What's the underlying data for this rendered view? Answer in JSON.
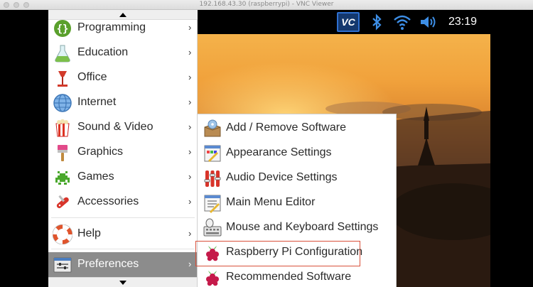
{
  "window": {
    "title": "192.168.43.30 (raspberrypi) - VNC Viewer"
  },
  "panel": {
    "clock": "23:19",
    "vnc_label": "VC"
  },
  "menu": {
    "items": [
      {
        "label": "Programming",
        "icon": "programming-icon"
      },
      {
        "label": "Education",
        "icon": "education-icon"
      },
      {
        "label": "Office",
        "icon": "office-icon"
      },
      {
        "label": "Internet",
        "icon": "internet-icon"
      },
      {
        "label": "Sound & Video",
        "icon": "sound-video-icon"
      },
      {
        "label": "Graphics",
        "icon": "graphics-icon"
      },
      {
        "label": "Games",
        "icon": "games-icon"
      },
      {
        "label": "Accessories",
        "icon": "accessories-icon"
      },
      {
        "label": "Help",
        "icon": "help-icon"
      },
      {
        "label": "Preferences",
        "icon": "preferences-icon",
        "selected": true
      }
    ]
  },
  "submenu": {
    "items": [
      {
        "label": "Add / Remove Software",
        "icon": "add-remove-software-icon"
      },
      {
        "label": "Appearance Settings",
        "icon": "appearance-settings-icon"
      },
      {
        "label": "Audio Device Settings",
        "icon": "audio-device-settings-icon"
      },
      {
        "label": "Main Menu Editor",
        "icon": "main-menu-editor-icon"
      },
      {
        "label": "Mouse and Keyboard Settings",
        "icon": "mouse-keyboard-settings-icon"
      },
      {
        "label": "Raspberry Pi Configuration",
        "icon": "raspberry-icon",
        "highlighted": true
      },
      {
        "label": "Recommended Software",
        "icon": "raspberry-icon"
      }
    ]
  },
  "colors": {
    "highlight_border": "#d9503a",
    "selected_bg": "#8c8c8c",
    "vnc_blue": "#2e6fd0"
  }
}
